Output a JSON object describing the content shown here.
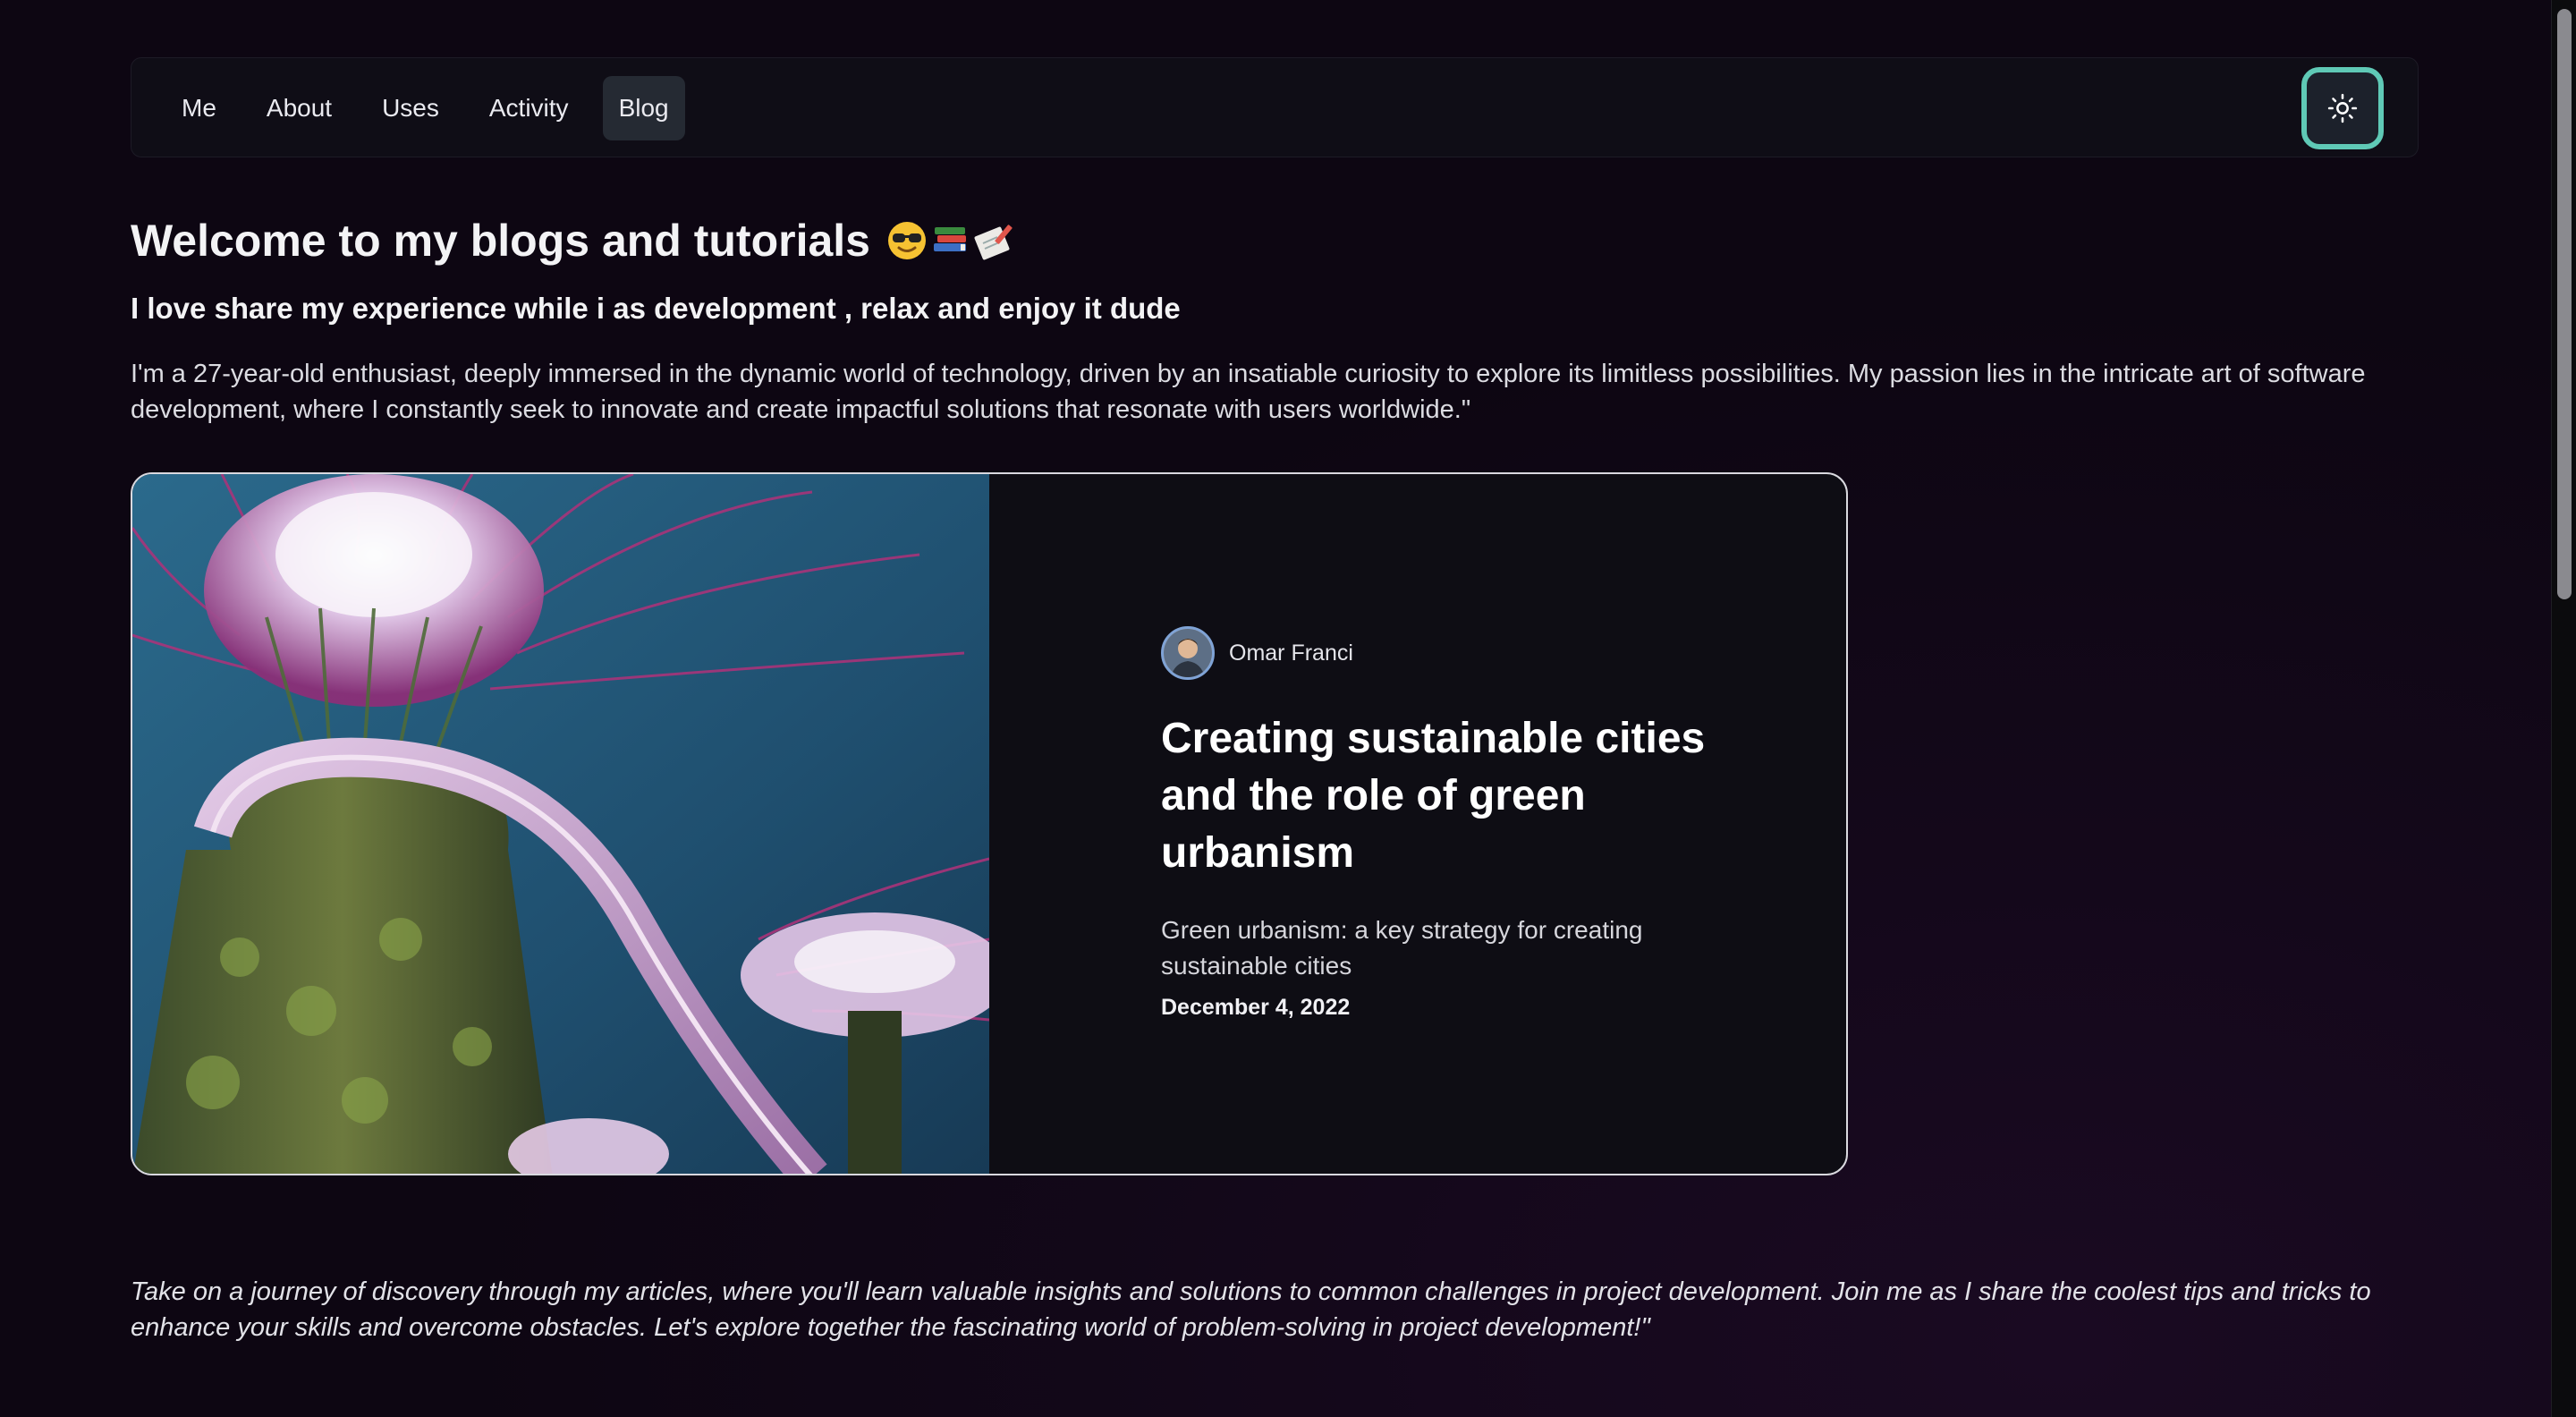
{
  "nav": {
    "items": [
      {
        "label": "Me",
        "active": false
      },
      {
        "label": "About",
        "active": false
      },
      {
        "label": "Uses",
        "active": false
      },
      {
        "label": "Activity",
        "active": false
      },
      {
        "label": "Blog",
        "active": true
      }
    ],
    "theme_toggle_icon": "sun-icon"
  },
  "header": {
    "title": "Welcome to my blogs and tutorials",
    "title_emojis": [
      "sunglasses-emoji",
      "books-emoji",
      "memo-emoji"
    ],
    "subtitle": "I love share my experience while i as development , relax and enjoy it dude",
    "intro": "I'm a 27-year-old enthusiast, deeply immersed in the dynamic world of technology, driven by an insatiable curiosity to explore its limitless possibilities. My passion lies in the intricate art of software development, where I constantly seek to innovate and create impactful solutions that resonate with users worldwide.\""
  },
  "post": {
    "author": "Omar Franci",
    "title": "Creating sustainable cities and the role of green urbanism",
    "excerpt": "Green urbanism: a key strategy for creating sustainable cities",
    "date": "December 4, 2022"
  },
  "footer": {
    "outro": "Take on a journey of discovery through my articles, where you'll learn valuable insights and solutions to common challenges in project development. Join me as I share the coolest tips and tricks to enhance your skills and overcome obstacles. Let's explore together the fascinating world of problem-solving in project development!\""
  },
  "colors": {
    "background": "#0d0612",
    "nav_bg": "#0f0d16",
    "active_tab": "#252a33",
    "accent_ring": "#5fc9b6"
  }
}
